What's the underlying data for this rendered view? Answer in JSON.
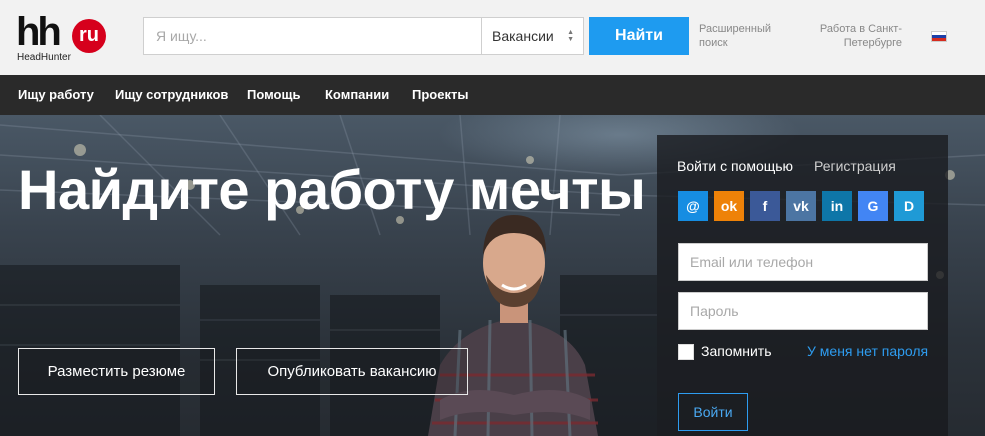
{
  "header": {
    "logo_mark": "hh",
    "logo_badge": "ru",
    "logo_caption": "HeadHunter",
    "search_placeholder": "Я ищу...",
    "search_value": "",
    "search_type": "Вакансии",
    "search_button": "Найти",
    "advanced_search": "Расширенный поиск",
    "region": "Работа в Санкт-Петербурге",
    "flag_colors": [
      "#ffffff",
      "#1c3fa8",
      "#d52b1e"
    ]
  },
  "nav": {
    "items": [
      "Ищу работу",
      "Ищу сотрудников",
      "Помощь",
      "Компании",
      "Проекты"
    ]
  },
  "hero": {
    "headline": "Найдите работу мечты",
    "post_resume": "Разместить резюме",
    "post_vacancy": "Опубликовать вакансию"
  },
  "login": {
    "tab_active": "Войти с помощью",
    "tab_register": "Регистрация",
    "socials": [
      {
        "name": "mail-ru",
        "glyph": "@",
        "color": "#168de2"
      },
      {
        "name": "odnoklassniki",
        "glyph": "ok",
        "color": "#ee8208"
      },
      {
        "name": "facebook",
        "glyph": "f",
        "color": "#3b5998"
      },
      {
        "name": "vkontakte",
        "glyph": "vk",
        "color": "#4c75a3"
      },
      {
        "name": "linkedin",
        "glyph": "in",
        "color": "#0e76a8"
      },
      {
        "name": "google",
        "glyph": "G",
        "color": "#4285f4"
      },
      {
        "name": "d",
        "glyph": "D",
        "color": "#1f9ad6"
      }
    ],
    "email_placeholder": "Email или телефон",
    "password_placeholder": "Пароль",
    "remember": "Запомнить",
    "no_password": "У меня нет пароля",
    "submit": "Войти"
  }
}
